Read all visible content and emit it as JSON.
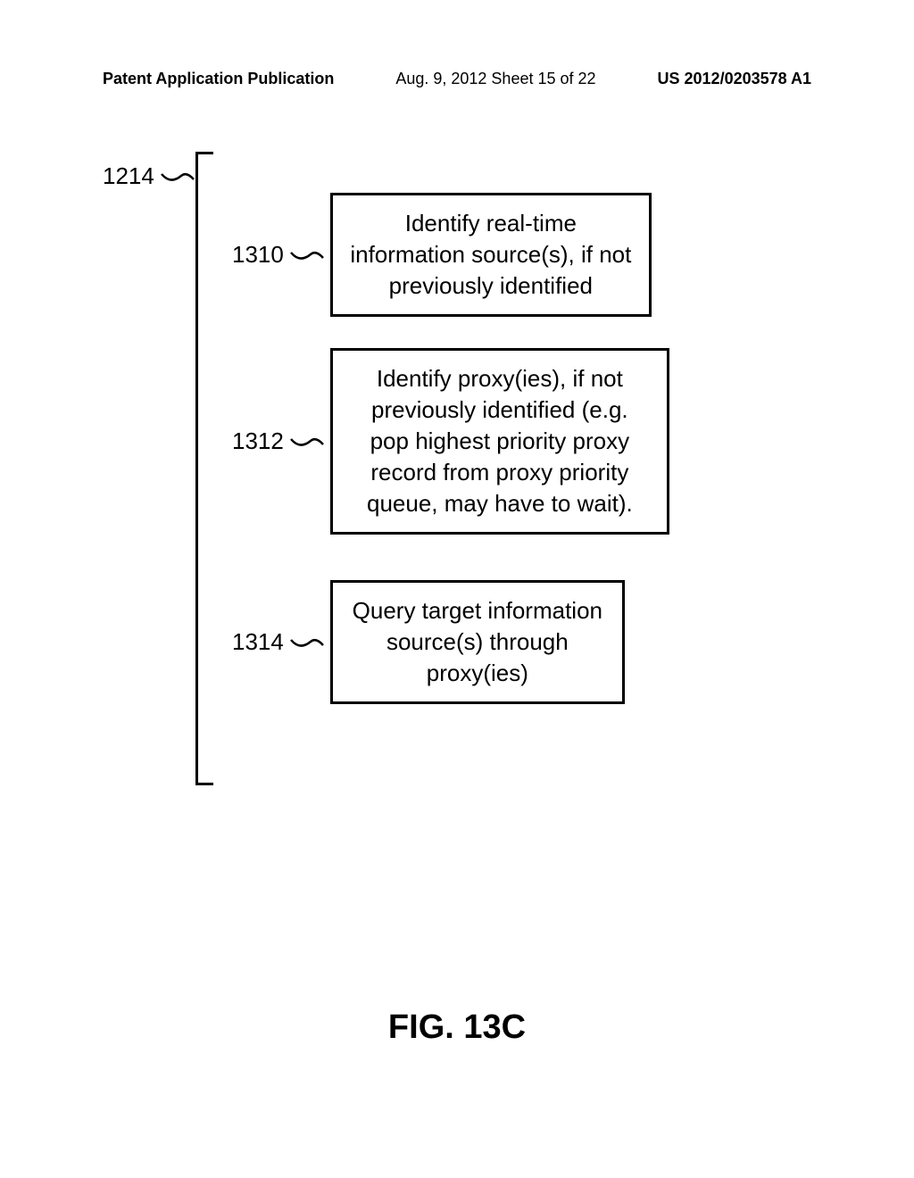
{
  "header": {
    "left": "Patent Application Publication",
    "center": "Aug. 9, 2012  Sheet 15 of 22",
    "right": "US 2012/0203578 A1"
  },
  "bracket_ref": "1214",
  "steps": [
    {
      "ref": "1310",
      "text": "Identify real-time information source(s), if not previously identified"
    },
    {
      "ref": "1312",
      "text": "Identify proxy(ies), if not previously identified (e.g. pop highest priority proxy record from proxy priority queue, may have to wait)."
    },
    {
      "ref": "1314",
      "text": "Query target information source(s) through proxy(ies)"
    }
  ],
  "figure_title": "FIG. 13C"
}
